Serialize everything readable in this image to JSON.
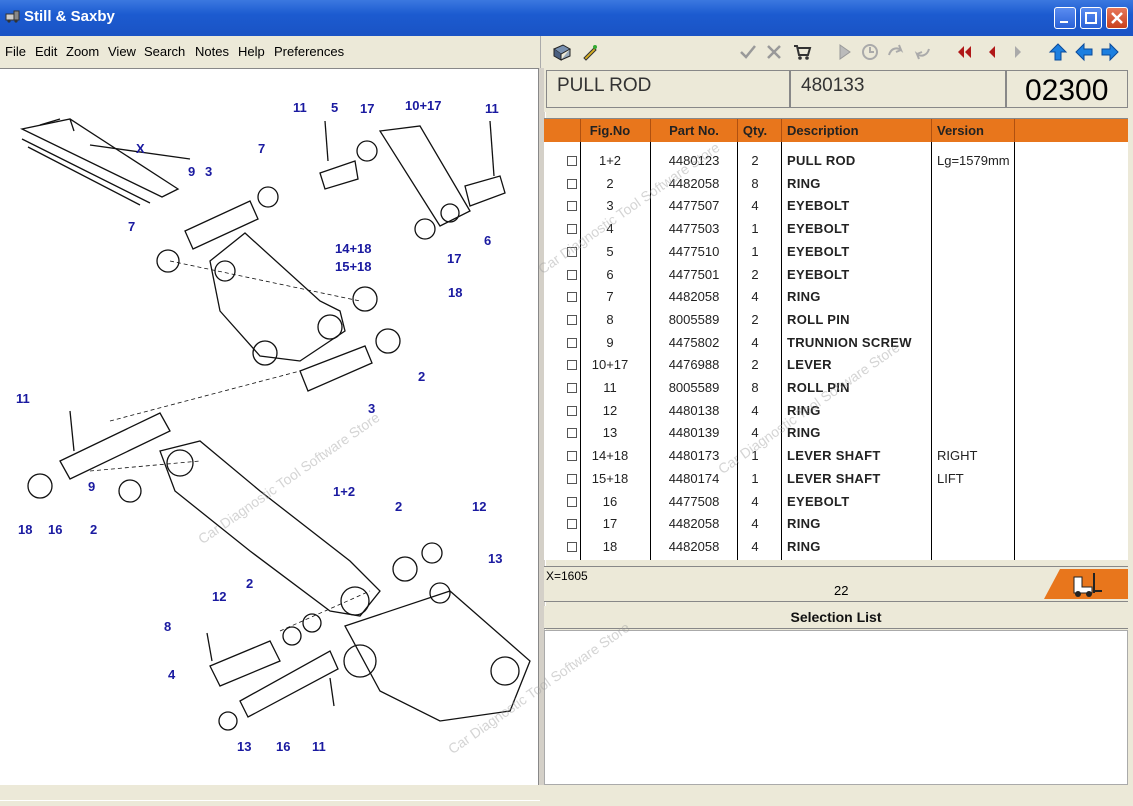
{
  "window": {
    "title": "Still & Saxby"
  },
  "menu": [
    "File",
    "Edit",
    "Zoom",
    "View",
    "Search",
    "Notes",
    "Help",
    "Preferences"
  ],
  "header": {
    "name": "PULL ROD",
    "number": "480133",
    "code": "02300"
  },
  "table": {
    "columns": [
      "Fig.No",
      "Part No.",
      "Qty.",
      "Description",
      "Version"
    ],
    "rows": [
      {
        "fig": "1+2",
        "part": "4480123",
        "qty": "2",
        "desc": "PULL ROD",
        "ver": "Lg=1579mm"
      },
      {
        "fig": "2",
        "part": "4482058",
        "qty": "8",
        "desc": "RING",
        "ver": ""
      },
      {
        "fig": "3",
        "part": "4477507",
        "qty": "4",
        "desc": "EYEBOLT",
        "ver": ""
      },
      {
        "fig": "4",
        "part": "4477503",
        "qty": "1",
        "desc": "EYEBOLT",
        "ver": ""
      },
      {
        "fig": "5",
        "part": "4477510",
        "qty": "1",
        "desc": "EYEBOLT",
        "ver": ""
      },
      {
        "fig": "6",
        "part": "4477501",
        "qty": "2",
        "desc": "EYEBOLT",
        "ver": ""
      },
      {
        "fig": "7",
        "part": "4482058",
        "qty": "4",
        "desc": "RING",
        "ver": ""
      },
      {
        "fig": "8",
        "part": "8005589",
        "qty": "2",
        "desc": "ROLL PIN",
        "ver": ""
      },
      {
        "fig": "9",
        "part": "4475802",
        "qty": "4",
        "desc": "TRUNNION SCREW",
        "ver": ""
      },
      {
        "fig": "10+17",
        "part": "4476988",
        "qty": "2",
        "desc": "LEVER",
        "ver": ""
      },
      {
        "fig": "11",
        "part": "8005589",
        "qty": "8",
        "desc": "ROLL PIN",
        "ver": ""
      },
      {
        "fig": "12",
        "part": "4480138",
        "qty": "4",
        "desc": "RING",
        "ver": ""
      },
      {
        "fig": "13",
        "part": "4480139",
        "qty": "4",
        "desc": "RING",
        "ver": ""
      },
      {
        "fig": "14+18",
        "part": "4480173",
        "qty": "1",
        "desc": "LEVER SHAFT",
        "ver": "RIGHT"
      },
      {
        "fig": "15+18",
        "part": "4480174",
        "qty": "1",
        "desc": "LEVER SHAFT",
        "ver": "LIFT"
      },
      {
        "fig": "16",
        "part": "4477508",
        "qty": "4",
        "desc": "EYEBOLT",
        "ver": ""
      },
      {
        "fig": "17",
        "part": "4482058",
        "qty": "4",
        "desc": "RING",
        "ver": ""
      },
      {
        "fig": "18",
        "part": "4482058",
        "qty": "4",
        "desc": "RING",
        "ver": ""
      }
    ]
  },
  "status": {
    "coord": "X=1605",
    "count": "22"
  },
  "selection": {
    "title": "Selection List"
  },
  "diagram": {
    "labels": [
      "11",
      "5",
      "17",
      "10+17",
      "11",
      "7",
      "9",
      "3",
      "X",
      "7",
      "14+18",
      "15+18",
      "17",
      "6",
      "18",
      "2",
      "3",
      "11",
      "9",
      "1+2",
      "18",
      "16",
      "2",
      "2",
      "12",
      "13",
      "2",
      "12",
      "8",
      "4",
      "13",
      "16",
      "11"
    ]
  },
  "watermark": "Car Diagnostic Tool Software Store"
}
